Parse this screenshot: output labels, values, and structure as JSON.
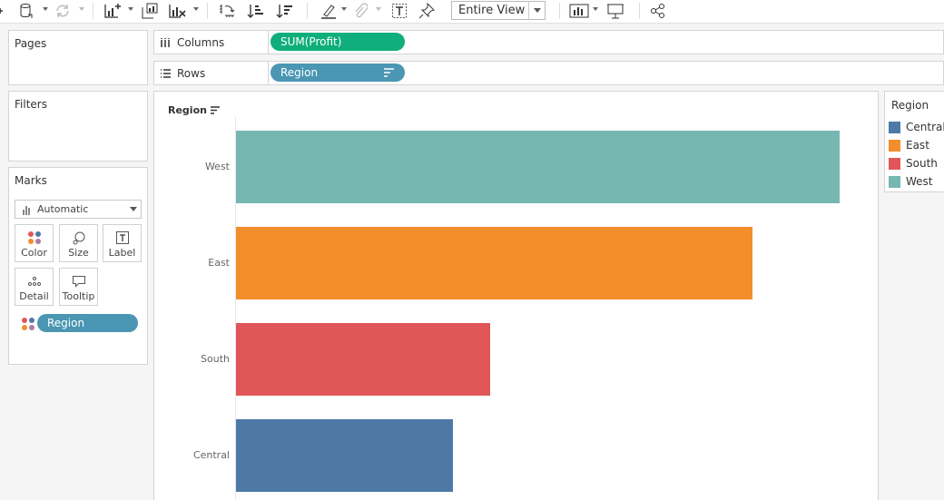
{
  "toolbar": {
    "view_mode": "Entire View",
    "icons": [
      "add-datasource-icon",
      "datasource-icon",
      "refresh-icon",
      "new-sheet-icon",
      "duplicate-sheet-icon",
      "clear-sheet-icon",
      "swap-icon",
      "sort-ascending-icon",
      "sort-descending-icon",
      "highlight-icon",
      "group-icon",
      "labels-icon",
      "pin-icon",
      "show-me-icon",
      "presentation-icon",
      "share-icon"
    ]
  },
  "cards": {
    "pages": "Pages",
    "filters": "Filters",
    "marks": {
      "title": "Marks",
      "mark_type": "Automatic",
      "buttons": [
        "Color",
        "Size",
        "Label",
        "Detail",
        "Tooltip"
      ],
      "field_pill": "Region"
    }
  },
  "shelves": {
    "columns": {
      "label": "Columns",
      "pill": "SUM(Profit)"
    },
    "rows": {
      "label": "Rows",
      "pill": "Region"
    }
  },
  "chart_data": {
    "type": "bar",
    "orientation": "horizontal",
    "header": "Region",
    "categories": [
      "West",
      "East",
      "South",
      "Central"
    ],
    "relative_values": [
      1.0,
      0.856,
      0.421,
      0.359
    ],
    "colors": [
      "#76b7b2",
      "#f28e2b",
      "#e15759",
      "#4e79a7"
    ],
    "grid": false
  },
  "legend": {
    "title": "Region",
    "items": [
      {
        "label": "Central",
        "color": "#4e79a7"
      },
      {
        "label": "East",
        "color": "#f28e2b"
      },
      {
        "label": "South",
        "color": "#e15759"
      },
      {
        "label": "West",
        "color": "#76b7b2"
      }
    ]
  }
}
